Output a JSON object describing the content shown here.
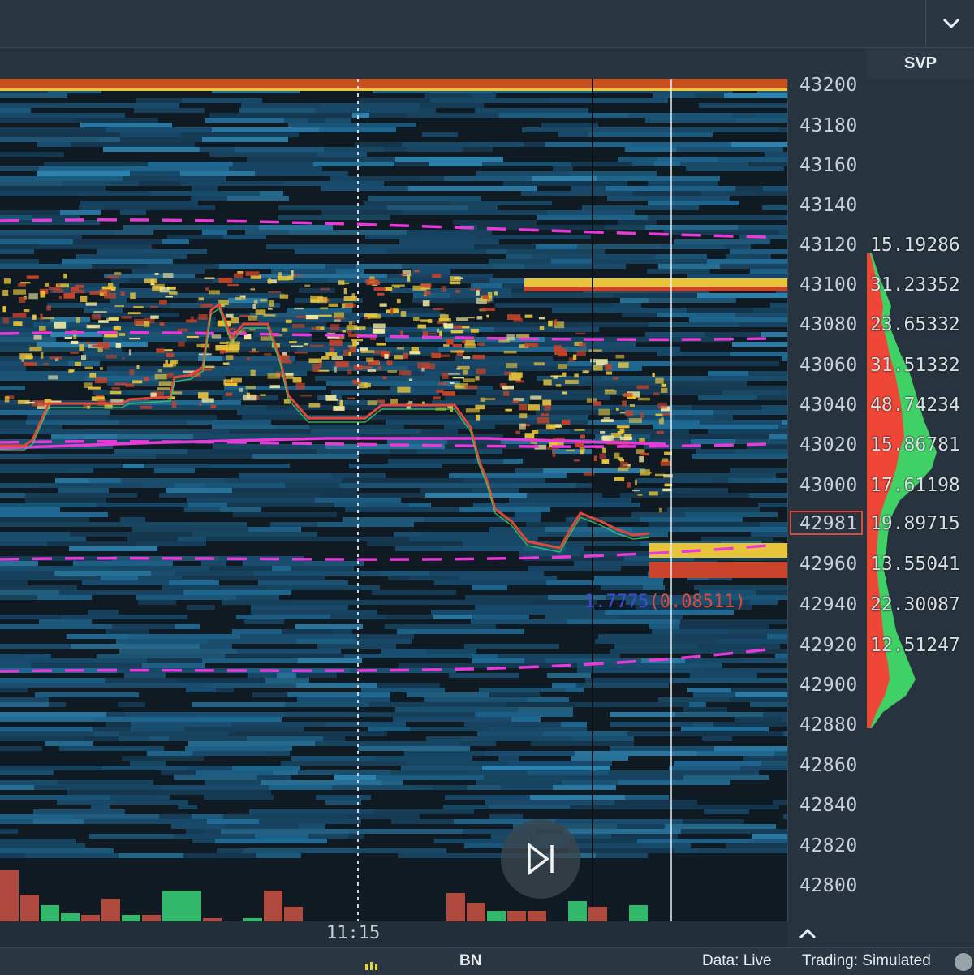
{
  "svp_tab": {
    "label": "SVP"
  },
  "price_axis": {
    "labels": [
      "43200",
      "43180",
      "43160",
      "43140",
      "43120",
      "43100",
      "43080",
      "43060",
      "43040",
      "43020",
      "43000",
      "42981",
      "42960",
      "42940",
      "42920",
      "42900",
      "42880",
      "42860",
      "42840",
      "42820",
      "42800"
    ],
    "current_price": "42981"
  },
  "svp": {
    "values": [
      "15.19286",
      "31.23352",
      "23.65332",
      "31.51332",
      "48.74234",
      "15.86781",
      "17.61198",
      "19.89715",
      "13.55041",
      "22.30087",
      "12.51247"
    ]
  },
  "current_price_text": {
    "size": "1.7775",
    "delta": "(0.08511)"
  },
  "time_axis": {
    "label": "11:15"
  },
  "status_bar": {
    "exchange": "BN",
    "data": "Data: Live",
    "trading": "Trading: Simulated"
  },
  "colors": {
    "heatmap_blue": "#1f6b96",
    "heatmap_yellow": "#e8c43a",
    "heatmap_red": "#c8432a",
    "vwap_magenta": "#e83ad8",
    "price_line": "#e0493a",
    "svp_green": "#3fd066",
    "svp_red": "#ee4637"
  },
  "icons": {
    "dropdown": "chevron-down-icon",
    "collapse": "chevron-up-icon",
    "play": "skip-forward-icon"
  }
}
